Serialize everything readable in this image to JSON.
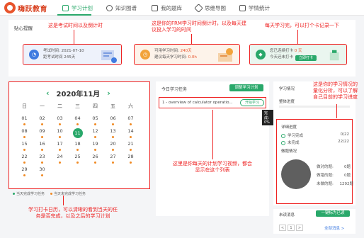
{
  "app": {
    "logo_text": "嗨跃教育",
    "nav": [
      {
        "label": "学习计划",
        "icon": "calendar-icon",
        "active": true
      },
      {
        "label": "知识图谱",
        "icon": "graph-icon",
        "active": false
      },
      {
        "label": "我的题库",
        "icon": "book-icon",
        "active": false
      },
      {
        "label": "思维导图",
        "icon": "mindmap-icon",
        "active": false
      },
      {
        "label": "学情统计",
        "icon": "chart-icon",
        "active": false
      }
    ],
    "accent_color": "#29a86a",
    "annotation_color": "#ee2222"
  },
  "reminder": {
    "title": "贴心提醒",
    "exam_card": {
      "exam_label": "考试时间:",
      "exam_date": "2021-07-10",
      "days_label": "距考试时间",
      "days_value": "245天",
      "icon": "bell-icon"
    },
    "study_card": {
      "available_label": "可用学习时间:",
      "available_value": "240天",
      "suggest_label": "建议每天学习时间:",
      "suggest_value": "0.0h",
      "icon": "clock-icon"
    },
    "checkin_card": {
      "streak_label": "您已连续打卡",
      "streak_value": "0 天",
      "today_label": "今天还未打卡",
      "button": "立即打卡",
      "icon": "gift-icon"
    }
  },
  "calendar": {
    "month_label": "2020年11月",
    "weekdays": [
      "日",
      "一",
      "二",
      "三",
      "四",
      "五",
      "六"
    ],
    "weeks": [
      [
        "01",
        "02",
        "03",
        "04",
        "05",
        "06",
        "07"
      ],
      [
        "08",
        "09",
        "10",
        "11",
        "12",
        "13",
        "14"
      ],
      [
        "15",
        "16",
        "17",
        "18",
        "19",
        "20",
        "21"
      ],
      [
        "22",
        "23",
        "24",
        "25",
        "26",
        "27",
        "28"
      ],
      [
        "29",
        "30",
        "",
        "",
        "",
        "",
        ""
      ]
    ],
    "today": "11",
    "legend_done": "当天完成学习任务",
    "legend_undone": "当天未完成学习任务",
    "done_color": "#29a86a",
    "undone_color": "#f08a24"
  },
  "tasks": {
    "title": "今日学习任务",
    "adjust_button": "调整学习计划",
    "items": [
      {
        "label": "1 - overview of calculator operatio...",
        "action": "开始学习"
      }
    ],
    "tooltip": "完成：0%"
  },
  "side": {
    "title": "学习情况",
    "progress_label": "整体进度",
    "detail_title": "详细进度",
    "done_label": "学习完成",
    "done_value": "0/22",
    "undone_label": "未完成",
    "undone_value": "22/22",
    "practice_title": "做题情况",
    "practice_rows": [
      {
        "label": "做对的题:",
        "value": "0题"
      },
      {
        "label": "做错的题:",
        "value": "0题"
      },
      {
        "label": "未做的题:",
        "value": "1292题"
      }
    ]
  },
  "messages": {
    "title": "未读消息",
    "button": "一键标为已读",
    "more": "全部消息 >",
    "pager_prev": "<",
    "pager_page": "1",
    "pager_next": ">"
  },
  "annotations": {
    "exam": "这是考试时间以及倒计时",
    "frm": "这是你的FRM学习时间倒计时，以及每天建议投入学习的时间",
    "checkin": "每天学习完，可以打个卡记录一下",
    "stats": "这是你的学习情况的量化分析，可以了解自己目前的学习进度",
    "tasks": "这里是你每天的计划学习视频，都会显示在这个列表",
    "calendar": "学习打卡日历，可以清晰的看到当天的任务是否完成，以及之后的学习计划"
  }
}
